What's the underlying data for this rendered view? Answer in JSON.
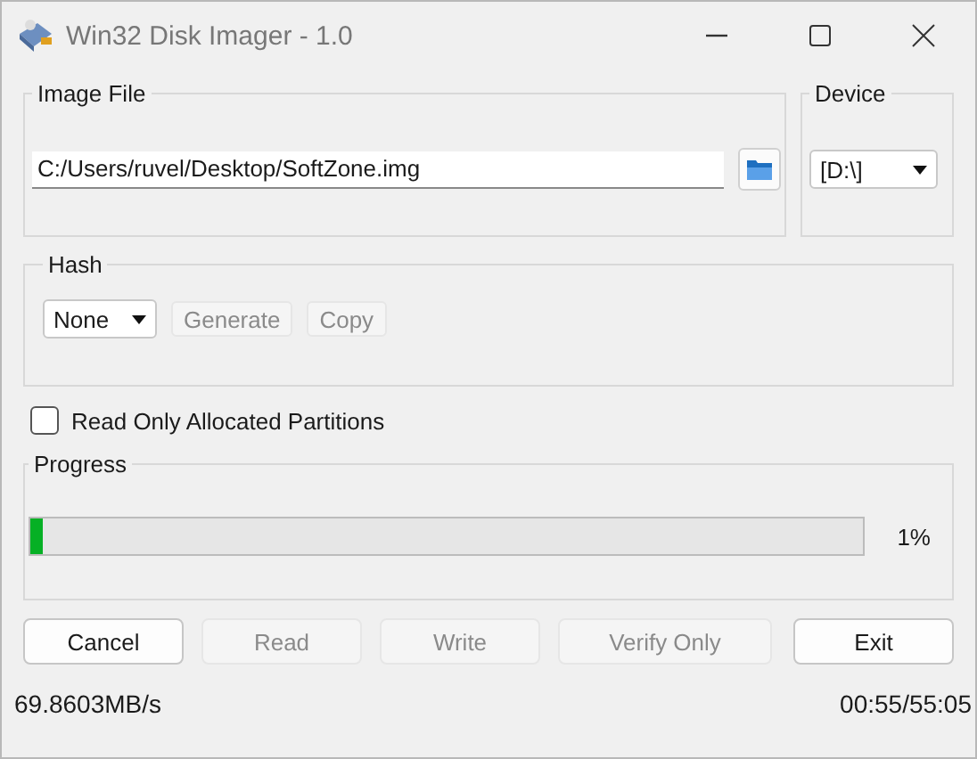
{
  "window": {
    "title": "Win32 Disk Imager - 1.0"
  },
  "image_file": {
    "label": "Image File",
    "value": "C:/Users/ruvel/Desktop/SoftZone.img"
  },
  "device": {
    "label": "Device",
    "value": "[D:\\]"
  },
  "hash": {
    "label": "Hash",
    "value": "None",
    "buttons": [
      {
        "label": "Generate",
        "disabled": true
      },
      {
        "label": "Copy",
        "disabled": true
      }
    ]
  },
  "read_only_allocated": {
    "label": "Read Only Allocated Partitions",
    "checked": false
  },
  "progress": {
    "label": "Progress",
    "level": 0.015,
    "reading": "1%"
  },
  "buttons": [
    {
      "label": "Cancel",
      "disabled": false
    },
    {
      "label": "Read",
      "disabled": true
    },
    {
      "label": "Write",
      "disabled": true
    },
    {
      "label": "Verify Only",
      "disabled": true
    },
    {
      "label": "Exit",
      "disabled": false
    }
  ],
  "status_bar": {
    "speed": "69.8603MB/s",
    "time": "00:55/55:05"
  }
}
